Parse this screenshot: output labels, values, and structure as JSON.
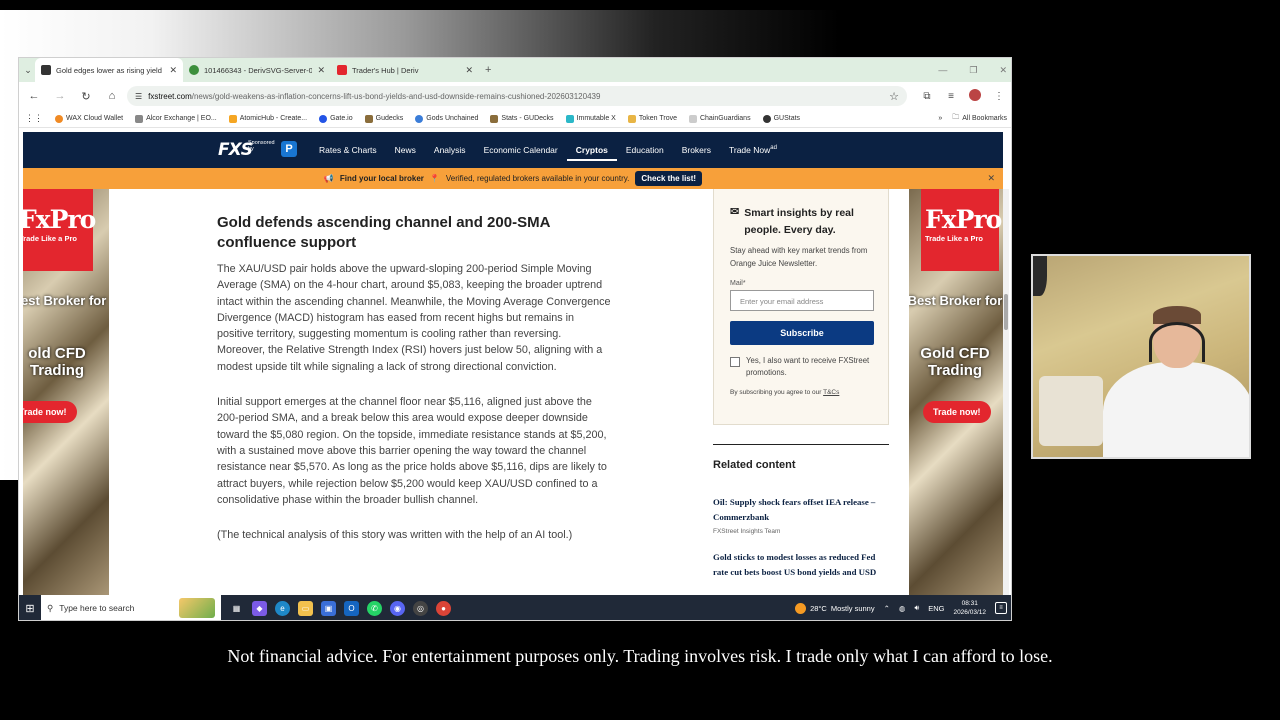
{
  "browser": {
    "tabs": [
      {
        "title": "Gold edges lower as rising yield",
        "active": true,
        "favicon_color": "#333333"
      },
      {
        "title": "101466343 - DerivSVG-Server-0",
        "active": false,
        "favicon_color": "#3c8f3c"
      },
      {
        "title": "Trader's Hub | Deriv",
        "active": false,
        "favicon_color": "#e3262e"
      }
    ],
    "url_host": "fxstreet.com",
    "url_path": "/news/gold-weakens-as-inflation-concerns-lift-us-bond-yields-and-usd-downside-remains-cushioned-202603120439",
    "bookmarks": [
      {
        "label": "WAX Cloud Wallet",
        "color": "#f08a24"
      },
      {
        "label": "Alcor Exchange | EO...",
        "color": "#888888"
      },
      {
        "label": "AtomicHub - Create...",
        "color": "#f5a623"
      },
      {
        "label": "Gate.io",
        "color": "#2354e6"
      },
      {
        "label": "Gudecks",
        "color": "#8a6d3b"
      },
      {
        "label": "Gods Unchained",
        "color": "#3b7dd8"
      },
      {
        "label": "Stats - GUDecks",
        "color": "#8a6d3b"
      },
      {
        "label": "Immutable X",
        "color": "#2bb8c8"
      },
      {
        "label": "Token Trove",
        "color": "#e8b545"
      },
      {
        "label": "ChainGuardians",
        "color": "#cccccc"
      },
      {
        "label": "GUStats",
        "color": "#333333"
      }
    ],
    "all_bookmarks": "All Bookmarks"
  },
  "site": {
    "logo": "FXS",
    "sponsored_by": "Sponsored by",
    "sponsor_badge": "P",
    "nav": [
      {
        "label": "Rates & Charts"
      },
      {
        "label": "News"
      },
      {
        "label": "Analysis"
      },
      {
        "label": "Economic Calendar"
      },
      {
        "label": "Cryptos",
        "active": true
      },
      {
        "label": "Education"
      },
      {
        "label": "Brokers"
      },
      {
        "label": "Trade Now",
        "sup": "ad"
      }
    ],
    "banner": {
      "lead": "Find your local broker",
      "text": "Verified, regulated brokers available in your country.",
      "cta": "Check the list!"
    }
  },
  "ad": {
    "brand": "FxPro",
    "tagline": "Trade Like a Pro",
    "headline_left": "Best Broker for",
    "headline_right": "Best Broker for",
    "product_left": "old CFD Trading",
    "product_right": "Gold CFD Trading",
    "cta": "Trade now!"
  },
  "article": {
    "heading": "Gold defends ascending channel and 200-SMA confluence support",
    "paragraphs": [
      "The XAU/USD pair holds above the upward-sloping 200-period Simple Moving Average (SMA) on the 4-hour chart, around $5,083, keeping the broader uptrend intact within the ascending channel. Meanwhile, the Moving Average Convergence Divergence (MACD) histogram has eased from recent highs but remains in positive territory, suggesting momentum is cooling rather than reversing. Moreover, the Relative Strength Index (RSI) hovers just below 50, aligning with a modest upside tilt while signaling a lack of strong directional conviction.",
      "Initial support emerges at the channel floor near $5,116, aligned just above the 200-period SMA, and a break below this area would expose deeper downside toward the $5,080 region. On the topside, immediate resistance stands at $5,200, with a sustained move above this barrier opening the way toward the channel resistance near $5,570. As long as the price holds above $5,116, dips are likely to attract buyers, while rejection below $5,200 would keep XAU/USD confined to a consolidative phase within the broader bullish channel.",
      "(The technical analysis of this story was written with the help of an AI tool.)"
    ]
  },
  "newsletter": {
    "heading": "Smart insights by real people. Every day.",
    "subtext": "Stay ahead with key market trends from Orange Juice Newsletter.",
    "mail_label": "Mail*",
    "email_placeholder": "Enter your email address",
    "subscribe": "Subscribe",
    "checkbox_label": "Yes, I also want to receive FXStreet promotions.",
    "terms_prefix": "By subscribing you agree to our ",
    "terms_link": "T&Cs"
  },
  "related": {
    "heading": "Related content",
    "items": [
      {
        "title": "Oil: Supply shock fears offset IEA release – Commerzbank",
        "author": "FXStreet Insights Team"
      },
      {
        "title": "Gold sticks to modest losses as reduced Fed rate cut bets boost US bond yields and USD",
        "author": ""
      }
    ]
  },
  "taskbar": {
    "search_placeholder": "Type here to search",
    "weather_temp": "28°C",
    "weather_text": "Mostly sunny",
    "lang": "ENG",
    "time": "08:31",
    "date": "2026/03/12"
  },
  "caption": "Not financial advice. For entertainment purposes only. Trading involves risk. I trade only what I can afford to lose."
}
